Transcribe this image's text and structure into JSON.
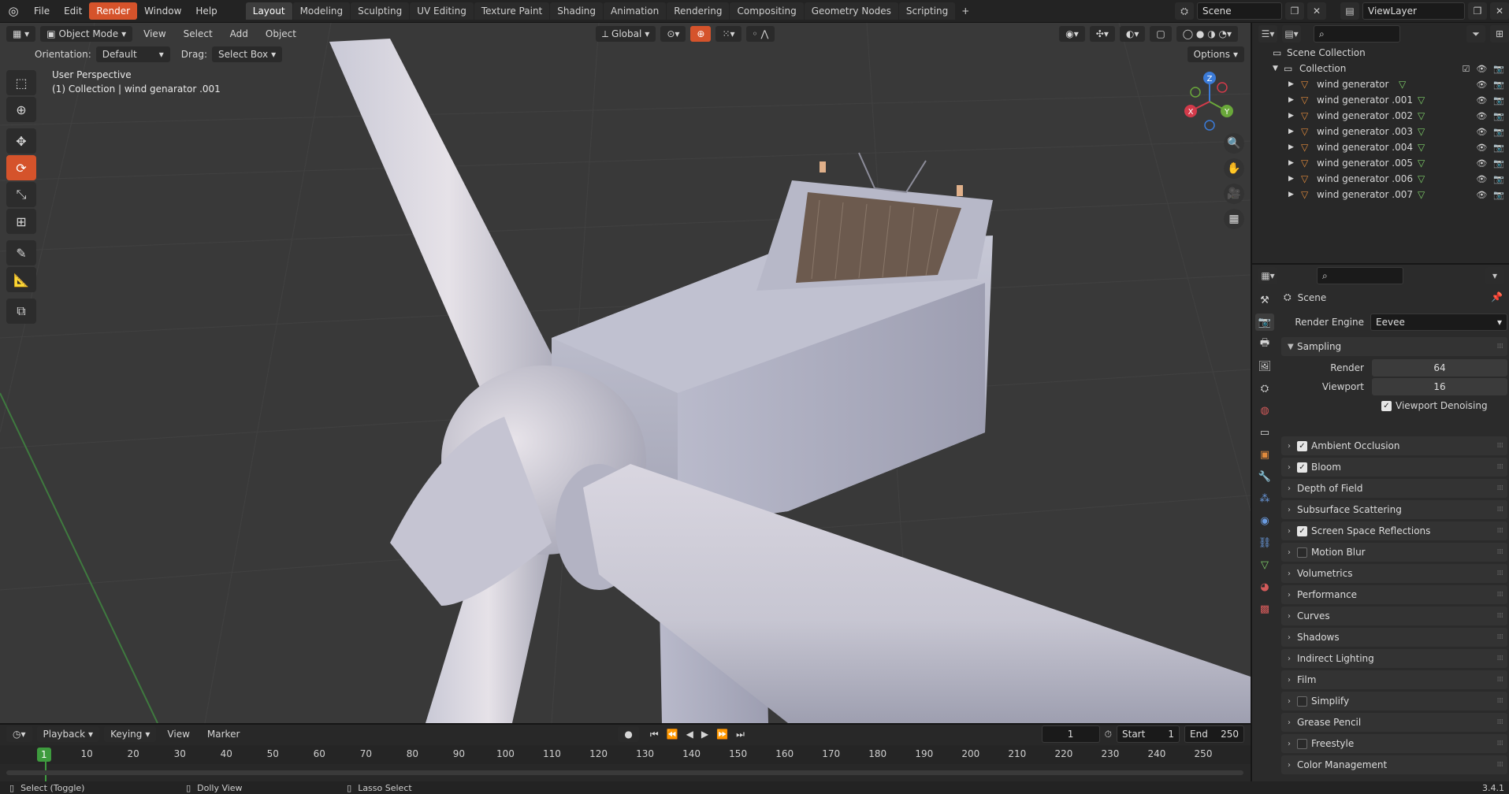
{
  "menu": {
    "items": [
      "File",
      "Edit",
      "Render",
      "Window",
      "Help"
    ],
    "active_index": 2
  },
  "workspaces": [
    "Layout",
    "Modeling",
    "Sculpting",
    "UV Editing",
    "Texture Paint",
    "Shading",
    "Animation",
    "Rendering",
    "Compositing",
    "Geometry Nodes",
    "Scripting"
  ],
  "workspace_add": "+",
  "scene_field": "Scene",
  "viewlayer_field": "ViewLayer",
  "viewport": {
    "mode": "Object Mode",
    "menus": [
      "View",
      "Select",
      "Add",
      "Object"
    ],
    "transform_orientation": "Global",
    "orientation_label": "Orientation:",
    "orientation_value": "Default",
    "drag_label": "Drag:",
    "drag_value": "Select Box",
    "options": "Options",
    "info_line1": "User Perspective",
    "info_line2": "(1) Collection | wind genarator .001",
    "gizmo": {
      "x": "X",
      "y": "Y",
      "z": "Z"
    }
  },
  "outliner": {
    "scene_collection": "Scene Collection",
    "collection": "Collection",
    "objects": [
      "wind generator",
      "wind generator .001",
      "wind generator .002",
      "wind generator .003",
      "wind generator .004",
      "wind generator .005",
      "wind generator .006",
      "wind generator .007"
    ]
  },
  "properties": {
    "context": "Scene",
    "render_engine_label": "Render Engine",
    "render_engine": "Eevee",
    "sampling_label": "Sampling",
    "render_label": "Render",
    "render_samples": "64",
    "viewport_label": "Viewport",
    "viewport_samples": "16",
    "viewport_denoising": "Viewport Denoising",
    "panels": [
      {
        "label": "Ambient Occlusion",
        "check": "on"
      },
      {
        "label": "Bloom",
        "check": "on"
      },
      {
        "label": "Depth of Field",
        "check": "none"
      },
      {
        "label": "Subsurface Scattering",
        "check": "none"
      },
      {
        "label": "Screen Space Reflections",
        "check": "on"
      },
      {
        "label": "Motion Blur",
        "check": "off"
      },
      {
        "label": "Volumetrics",
        "check": "none"
      },
      {
        "label": "Performance",
        "check": "none"
      },
      {
        "label": "Curves",
        "check": "none"
      },
      {
        "label": "Shadows",
        "check": "none"
      },
      {
        "label": "Indirect Lighting",
        "check": "none"
      },
      {
        "label": "Film",
        "check": "none"
      },
      {
        "label": "Simplify",
        "check": "off"
      },
      {
        "label": "Grease Pencil",
        "check": "none"
      },
      {
        "label": "Freestyle",
        "check": "off"
      },
      {
        "label": "Color Management",
        "check": "none"
      }
    ]
  },
  "timeline": {
    "playback": "Playback",
    "keying": "Keying",
    "view": "View",
    "marker": "Marker",
    "current_frame": "1",
    "start_label": "Start",
    "start": "1",
    "end_label": "End",
    "end": "250",
    "ticks": [
      "10",
      "20",
      "30",
      "40",
      "50",
      "60",
      "70",
      "80",
      "90",
      "100",
      "110",
      "120",
      "130",
      "140",
      "150",
      "160",
      "170",
      "180",
      "190",
      "200",
      "210",
      "220",
      "230",
      "240",
      "250"
    ]
  },
  "status": {
    "select": "Select (Toggle)",
    "dolly": "Dolly View",
    "lasso": "Lasso Select",
    "version": "3.4.1"
  },
  "colors": {
    "accent": "#d5532b",
    "frame": "#3e9b3e",
    "turbine": "#cfd0dc"
  }
}
